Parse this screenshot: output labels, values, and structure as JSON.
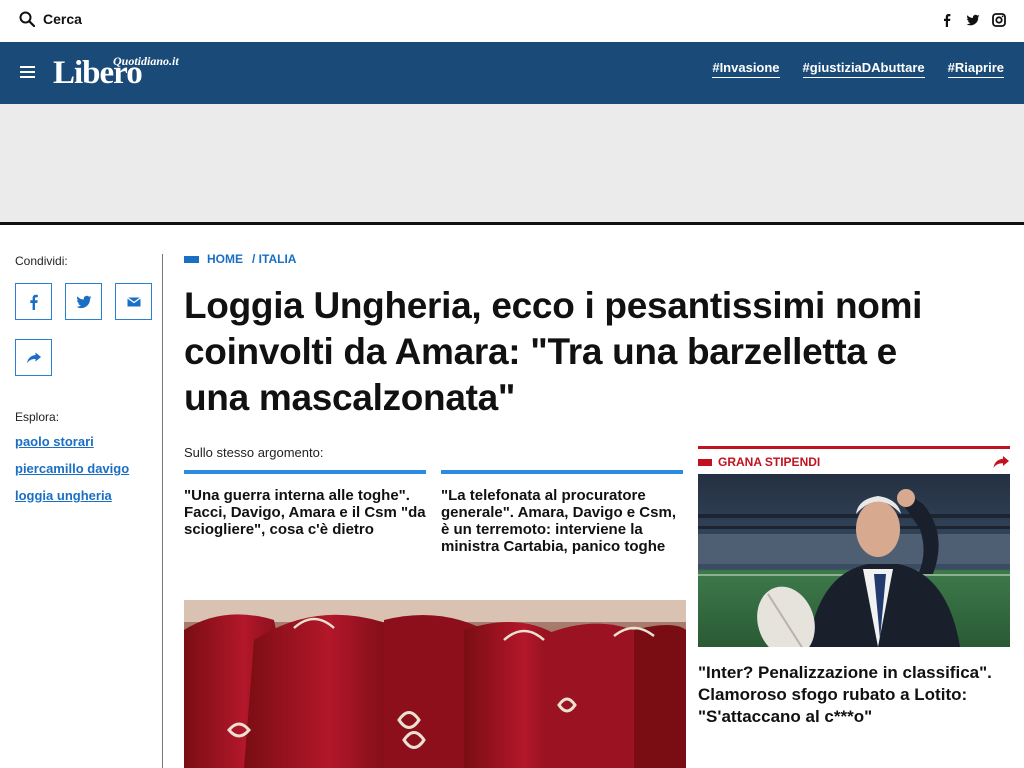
{
  "topbar": {
    "search_label": "Cerca",
    "socials": [
      "facebook-icon",
      "twitter-icon",
      "instagram-icon"
    ]
  },
  "header": {
    "logo_text": "Libero",
    "logo_sub": "Quotidiano.it",
    "bg_color": "#1a4b78",
    "tags": [
      "#Invasione",
      "#giustiziaDAbuttare",
      "#Riaprire"
    ]
  },
  "share": {
    "label": "Condividi:",
    "buttons": [
      "facebook-icon",
      "twitter-icon",
      "mail-icon",
      "share-arrow-icon"
    ]
  },
  "explore": {
    "label": "Esplora:",
    "links": [
      "paolo storari",
      "piercamillo davigo",
      "loggia ungheria"
    ]
  },
  "breadcrumb": {
    "home": "HOME",
    "section": "/ ITALIA"
  },
  "article": {
    "title": "Loggia Ungheria, ecco i pesantissimi nomi coinvolti da Amara: \"Tra una barzelletta e una mascalzonata\"",
    "related_label": "Sullo stesso argomento:",
    "related": [
      "\"Una guerra interna alle toghe\". Facci, Davigo, Amara e il Csm \"da sciogliere\", cosa c'è dietro",
      "\"La telefonata al procuratore generale\". Amara, Davigo e Csm, è un terremoto: interviene la ministra Cartabia, panico toghe"
    ]
  },
  "sidebar_card": {
    "category": "GRANA STIPENDI",
    "headline": "\"Inter? Penalizzazione in classifica\". Clamoroso sfogo rubato a Lotito: \"S'attaccano al c***o\""
  },
  "colors": {
    "accent_blue": "#1a6fc4",
    "accent_red": "#c1121f"
  }
}
